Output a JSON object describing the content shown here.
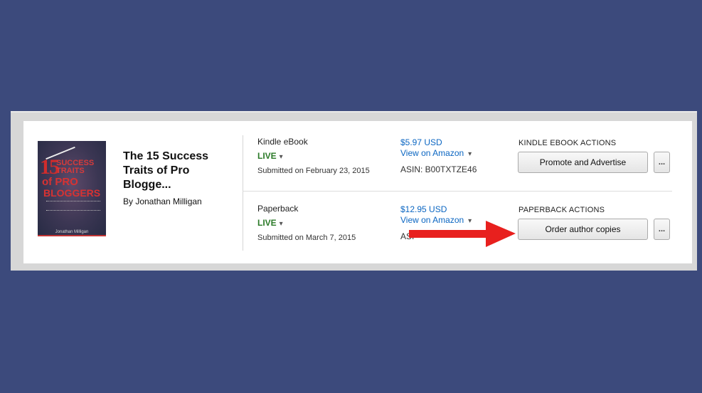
{
  "book": {
    "title": "The 15 Success Traits of Pro Blogge...",
    "author": "By Jonathan Milligan",
    "cover": {
      "number": "15",
      "line1": "SUCCESS",
      "line2": "TRAITS",
      "line3": "of PRO",
      "line4": "BLOGGERS",
      "author": "Jonathan Milligan"
    }
  },
  "formats": [
    {
      "name": "Kindle eBook",
      "status": "LIVE",
      "submitted": "Submitted on February 23, 2015",
      "price": "$5.97 USD",
      "view_link": "View on Amazon",
      "asin": "ASIN: B00TXTZE46",
      "actions_label": "KINDLE EBOOK ACTIONS",
      "action_button": "Promote and Advertise",
      "more_button": "..."
    },
    {
      "name": "Paperback",
      "status": "LIVE",
      "submitted": "Submitted on March 7, 2015",
      "price": "$12.95 USD",
      "view_link": "View on Amazon",
      "asin": "ASI",
      "actions_label": "PAPERBACK ACTIONS",
      "action_button": "Order author copies",
      "more_button": "..."
    }
  ],
  "icons": {
    "chevron": "▾",
    "annotation_arrow": "red-arrow-icon"
  },
  "colors": {
    "background": "#3c4a7c",
    "live_status": "#2b7a28",
    "link": "#0b66c2",
    "annotation": "#e8201e"
  }
}
